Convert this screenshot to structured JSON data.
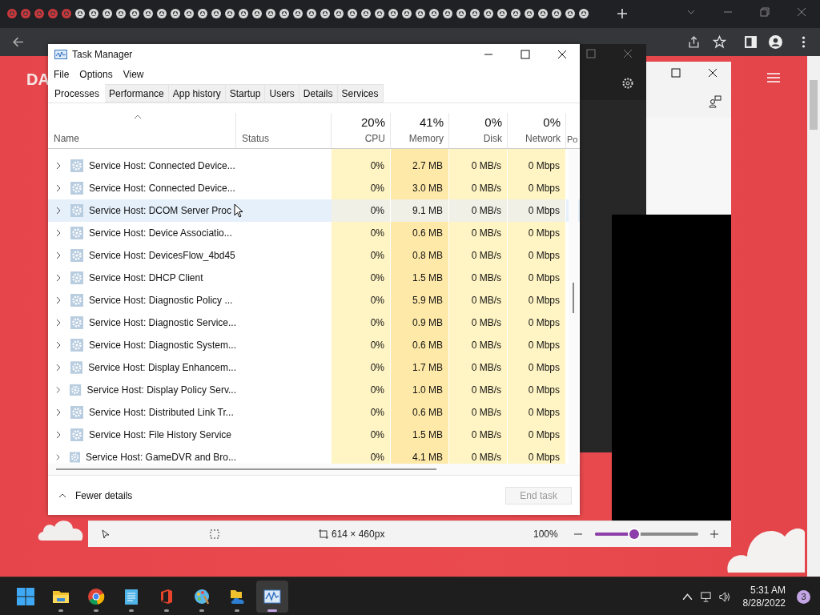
{
  "browser": {
    "tabs": [
      {
        "kind": "red"
      },
      {
        "kind": "red"
      },
      {
        "kind": "red"
      },
      {
        "kind": "red"
      },
      {
        "kind": "red"
      },
      {
        "kind": "grey"
      },
      {
        "kind": "grey"
      },
      {
        "kind": "grey"
      },
      {
        "kind": "grey"
      },
      {
        "kind": "grey"
      },
      {
        "kind": "grey"
      },
      {
        "kind": "grey"
      },
      {
        "kind": "grey"
      },
      {
        "kind": "grey"
      },
      {
        "kind": "grey"
      },
      {
        "kind": "grey"
      },
      {
        "kind": "grey"
      },
      {
        "kind": "grey"
      },
      {
        "kind": "grey"
      },
      {
        "kind": "grey"
      },
      {
        "kind": "grey"
      },
      {
        "kind": "grey"
      },
      {
        "kind": "grey"
      },
      {
        "kind": "grey"
      },
      {
        "kind": "grey"
      },
      {
        "kind": "grey"
      },
      {
        "kind": "grey"
      },
      {
        "kind": "grey"
      },
      {
        "kind": "grey"
      },
      {
        "kind": "grey"
      },
      {
        "kind": "grey"
      },
      {
        "kind": "grey"
      },
      {
        "kind": "grey"
      },
      {
        "kind": "grey"
      },
      {
        "kind": "grey"
      },
      {
        "kind": "grey"
      },
      {
        "kind": "grey"
      },
      {
        "kind": "grey"
      },
      {
        "kind": "grey"
      },
      {
        "kind": "grey"
      },
      {
        "kind": "grey"
      },
      {
        "kind": "grey"
      },
      {
        "kind": "grey"
      }
    ],
    "page_logo": "DA"
  },
  "task_manager": {
    "title": "Task Manager",
    "menu": [
      "File",
      "Options",
      "View"
    ],
    "tabs": [
      {
        "label": "Processes",
        "selected": true
      },
      {
        "label": "Performance",
        "selected": false
      },
      {
        "label": "App history",
        "selected": false
      },
      {
        "label": "Startup",
        "selected": false
      },
      {
        "label": "Users",
        "selected": false
      },
      {
        "label": "Details",
        "selected": false
      },
      {
        "label": "Services",
        "selected": false
      }
    ],
    "columns": [
      {
        "label": "Name"
      },
      {
        "label": "Status"
      },
      {
        "label": "CPU",
        "total": "20%"
      },
      {
        "label": "Memory",
        "total": "41%"
      },
      {
        "label": "Disk",
        "total": "0%"
      },
      {
        "label": "Network",
        "total": "0%"
      },
      {
        "label": "Po"
      }
    ],
    "rows": [
      {
        "name": "Service Host: Connected Device...",
        "cpu": "0%",
        "memory": "2.7 MB",
        "disk": "0 MB/s",
        "network": "0 Mbps",
        "hovered": false
      },
      {
        "name": "Service Host: Connected Device...",
        "cpu": "0%",
        "memory": "3.0 MB",
        "disk": "0 MB/s",
        "network": "0 Mbps",
        "hovered": false
      },
      {
        "name": "Service Host: DCOM Server Proc",
        "cpu": "0%",
        "memory": "9.1 MB",
        "disk": "0 MB/s",
        "network": "0 Mbps",
        "hovered": true
      },
      {
        "name": "Service Host: Device Associatio...",
        "cpu": "0%",
        "memory": "0.6 MB",
        "disk": "0 MB/s",
        "network": "0 Mbps",
        "hovered": false
      },
      {
        "name": "Service Host: DevicesFlow_4bd45",
        "cpu": "0%",
        "memory": "0.8 MB",
        "disk": "0 MB/s",
        "network": "0 Mbps",
        "hovered": false
      },
      {
        "name": "Service Host: DHCP Client",
        "cpu": "0%",
        "memory": "1.5 MB",
        "disk": "0 MB/s",
        "network": "0 Mbps",
        "hovered": false
      },
      {
        "name": "Service Host: Diagnostic Policy ...",
        "cpu": "0%",
        "memory": "5.9 MB",
        "disk": "0 MB/s",
        "network": "0 Mbps",
        "hovered": false
      },
      {
        "name": "Service Host: Diagnostic Service...",
        "cpu": "0%",
        "memory": "0.9 MB",
        "disk": "0 MB/s",
        "network": "0 Mbps",
        "hovered": false
      },
      {
        "name": "Service Host: Diagnostic System...",
        "cpu": "0%",
        "memory": "0.6 MB",
        "disk": "0 MB/s",
        "network": "0 Mbps",
        "hovered": false
      },
      {
        "name": "Service Host: Display Enhancem...",
        "cpu": "0%",
        "memory": "1.7 MB",
        "disk": "0 MB/s",
        "network": "0 Mbps",
        "hovered": false
      },
      {
        "name": "Service Host: Display Policy Serv...",
        "cpu": "0%",
        "memory": "1.0 MB",
        "disk": "0 MB/s",
        "network": "0 Mbps",
        "hovered": false
      },
      {
        "name": "Service Host: Distributed Link Tr...",
        "cpu": "0%",
        "memory": "0.6 MB",
        "disk": "0 MB/s",
        "network": "0 Mbps",
        "hovered": false
      },
      {
        "name": "Service Host: File History Service",
        "cpu": "0%",
        "memory": "1.5 MB",
        "disk": "0 MB/s",
        "network": "0 Mbps",
        "hovered": false
      },
      {
        "name": "Service Host: GameDVR and Bro...",
        "cpu": "0%",
        "memory": "4.1 MB",
        "disk": "0 MB/s",
        "network": "0 Mbps",
        "hovered": false
      }
    ],
    "footer": {
      "details_toggle": "Fewer details",
      "end_task": {
        "label": "End task",
        "disabled": true
      }
    }
  },
  "snipping_tool": {
    "size": "614 × 460px",
    "zoom": "100%",
    "zoom_slider": {
      "level": 0.38
    }
  },
  "taskbar": {
    "apps": [
      {
        "kind": "start",
        "running": false,
        "active": false
      },
      {
        "kind": "folder",
        "running": true,
        "active": false
      },
      {
        "kind": "chrome",
        "running": true,
        "active": false
      },
      {
        "kind": "notepad",
        "running": true,
        "active": false
      },
      {
        "kind": "office",
        "running": true,
        "active": false
      },
      {
        "kind": "paint",
        "running": true,
        "active": false
      },
      {
        "kind": "onedrive",
        "running": true,
        "active": false
      },
      {
        "kind": "monitor",
        "running": true,
        "active": true
      }
    ],
    "time": "5:31 AM",
    "date": "8/28/2022",
    "notifications": "3"
  }
}
